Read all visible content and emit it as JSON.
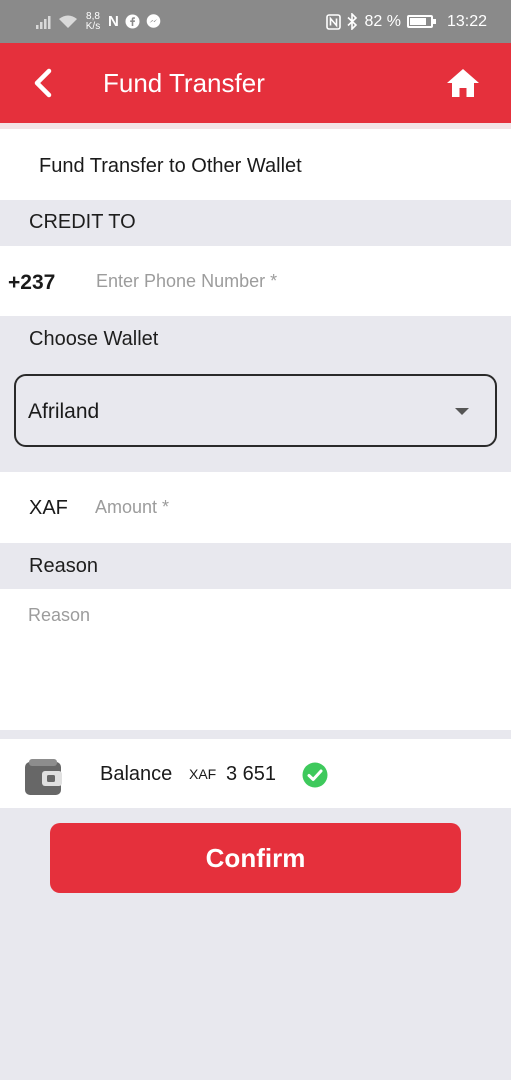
{
  "status_bar": {
    "net_speed_value": "8,8",
    "net_speed_unit": "K/s",
    "battery": "82 %",
    "battery_level": 0.82,
    "time": "13:22",
    "left_icons": [
      "signal-icon",
      "wifi-icon",
      "app-n-icon",
      "facebook-icon",
      "messenger-icon"
    ],
    "right_icons": [
      "nfc-icon",
      "bluetooth-icon",
      "battery-icon"
    ]
  },
  "app_bar": {
    "title": "Fund Transfer",
    "back_icon": "back-arrow-icon",
    "home_icon": "home-icon",
    "color": "#e5303c"
  },
  "form": {
    "heading": "Fund Transfer to Other Wallet",
    "credit_to_label": "CREDIT TO",
    "phone_prefix": "+237",
    "phone_placeholder": "Enter Phone Number *",
    "phone_value": "",
    "choose_wallet_label": "Choose Wallet",
    "wallet_selected": "Afriland",
    "currency_code": "XAF",
    "amount_placeholder": "Amount *",
    "amount_value": "",
    "reason_label": "Reason",
    "reason_placeholder": "Reason",
    "reason_value": ""
  },
  "balance": {
    "label": "Balance",
    "currency": "XAF",
    "value": "3 651",
    "status_icon": "check-circle-icon",
    "wallet_icon": "wallet-icon",
    "status_color": "#3ec95c"
  },
  "actions": {
    "confirm_label": "Confirm"
  }
}
